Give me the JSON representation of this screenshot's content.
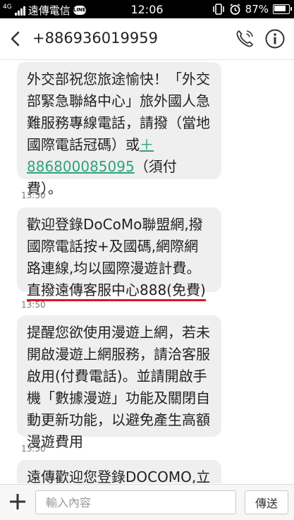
{
  "status_bar": {
    "signal_label": "4G",
    "carrier": "遠傳電信",
    "time": "12:06",
    "battery": "87%",
    "icons": [
      "signal-icon",
      "chat-app-icon",
      "vibrate-icon",
      "alarm-icon",
      "battery-icon"
    ]
  },
  "header": {
    "title": "+886936019959",
    "icons": [
      "back-arrow-icon",
      "phone-settings-icon",
      "info-icon"
    ]
  },
  "messages": [
    {
      "parts": [
        {
          "text": "外交部祝您旅途愉快！「外交部緊急聯絡中心」旅外國人急難服務專線電話，請撥（當地國際電話冠碼）或"
        },
        {
          "text": "＋886800085095",
          "link": true
        },
        {
          "text": "（須付費）。"
        }
      ],
      "timestamp": "13:50"
    },
    {
      "parts": [
        {
          "text": "歡迎登錄DoCoMo聯盟網,撥國際電話按+及國碼,網際網路連線,均以國際漫遊計費。"
        },
        {
          "text": "直撥遠傳客服中心888(免費)",
          "underlined": true
        }
      ],
      "timestamp": "13:50"
    },
    {
      "parts": [
        {
          "text": "提醒您欲使用漫遊上網，若未開啟漫遊上網服務，請洽客服啟用(付費電話)。並請開啟手機「數據漫遊」功能及關閉自動更新功能，以避免產生高額漫遊費用"
        }
      ],
      "timestamp": "13:50"
    },
    {
      "parts": [
        {
          "text": "遠傳歡迎您登錄DOCOMO,立"
        }
      ]
    }
  ],
  "input": {
    "placeholder": "輸入內容",
    "send_label": "傳送"
  },
  "colors": {
    "link": "#2fa37a",
    "underline_mark": "#d8162a",
    "bubble": "#efefef"
  }
}
